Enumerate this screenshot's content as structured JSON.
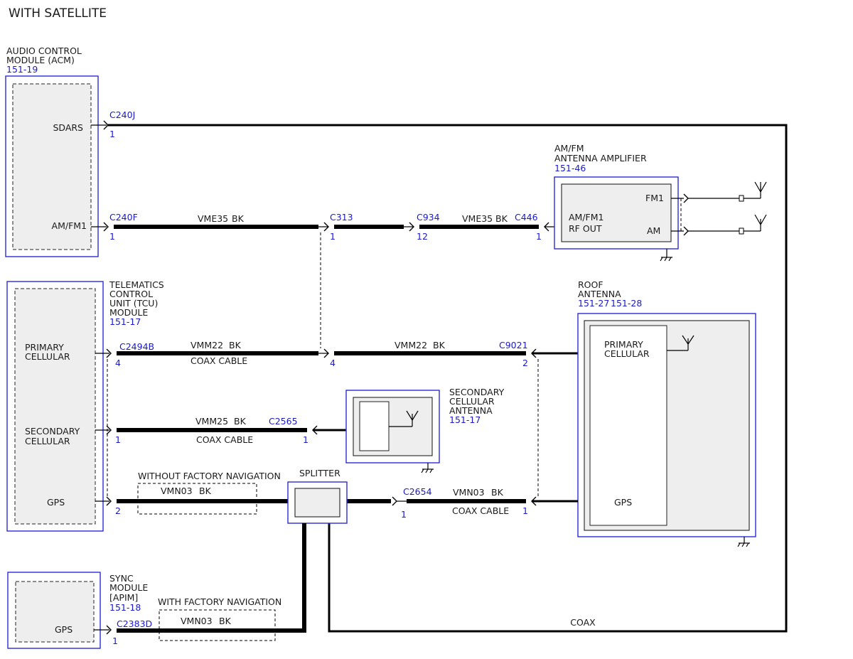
{
  "title": "WITH SATELLITE",
  "modules": {
    "acm": {
      "name_line1": "AUDIO CONTROL",
      "name_line2": "MODULE (ACM)",
      "ref": "151-19",
      "pin_sdars": "SDARS",
      "pin_amfm": "AM/FM1"
    },
    "tcu": {
      "name_line1": "TELEMATICS",
      "name_line2": "CONTROL",
      "name_line3": "UNIT (TCU)",
      "name_line4": "MODULE",
      "ref": "151-17",
      "pin_primary_1": "PRIMARY",
      "pin_primary_2": "CELLULAR",
      "pin_secondary_1": "SECONDARY",
      "pin_secondary_2": "CELLULAR",
      "pin_gps": "GPS"
    },
    "sync": {
      "name_line1": "SYNC",
      "name_line2": "MODULE",
      "name_line3": "[APIM]",
      "ref": "151-18",
      "pin_gps": "GPS"
    },
    "amp": {
      "name_line1": "AM/FM",
      "name_line2": "ANTENNA AMPLIFIER",
      "ref": "151-46",
      "pin_rf_1": "AM/FM1",
      "pin_rf_2": "RF OUT",
      "pin_fm1": "FM1",
      "pin_am": "AM"
    },
    "roof": {
      "name_line1": "ROOF",
      "name_line2": "ANTENNA",
      "ref1": "151-27",
      "ref2": "151-28",
      "pin_primary_1": "PRIMARY",
      "pin_primary_2": "CELLULAR",
      "pin_gps": "GPS"
    },
    "secondary_antenna": {
      "name_line1": "SECONDARY",
      "name_line2": "CELLULAR",
      "name_line3": "ANTENNA",
      "ref": "151-17"
    },
    "splitter": {
      "name": "SPLITTER"
    }
  },
  "connectors": {
    "c240j": {
      "id": "C240J",
      "pin": "1"
    },
    "c240f": {
      "id": "C240F",
      "pin": "1"
    },
    "c313": {
      "id": "C313",
      "pin": "1"
    },
    "c934": {
      "id": "C934",
      "pin": "12"
    },
    "c446": {
      "id": "C446",
      "pin": "1"
    },
    "c2494b": {
      "id": "C2494B",
      "pin": "4",
      "pin_right": "4"
    },
    "c9021": {
      "id": "C9021",
      "pin": "2"
    },
    "c2565": {
      "id": "C2565",
      "pin": "1"
    },
    "tcu_secondary_pin": "1",
    "tcu_gps_pin": "2",
    "c2654": {
      "id": "C2654",
      "pin": "1"
    },
    "roof_gps_pin": "1",
    "c2383d": {
      "id": "C2383D",
      "pin": "1"
    }
  },
  "wires": {
    "vme35_1": {
      "circuit": "VME35",
      "color": "BK"
    },
    "vme35_2": {
      "circuit": "VME35",
      "color": "BK"
    },
    "vmm22_1": {
      "circuit": "VMM22",
      "color": "BK",
      "note": "COAX CABLE"
    },
    "vmm22_2": {
      "circuit": "VMM22",
      "color": "BK"
    },
    "vmm25": {
      "circuit": "VMM25",
      "color": "BK",
      "note": "COAX CABLE"
    },
    "vmn03_1": {
      "circuit": "VMN03",
      "color": "BK"
    },
    "vmn03_2": {
      "circuit": "VMN03",
      "color": "BK",
      "note": "COAX CABLE"
    },
    "vmn03_3": {
      "circuit": "VMN03",
      "color": "BK"
    },
    "coax": "COAX"
  },
  "options": {
    "without_nav": "WITHOUT FACTORY NAVIGATION",
    "with_nav": "WITH FACTORY NAVIGATION"
  },
  "colors": {
    "ref_blue": "#1a1acc",
    "module_border": "#2b2bd6",
    "module_fill": "#eeeeee"
  }
}
